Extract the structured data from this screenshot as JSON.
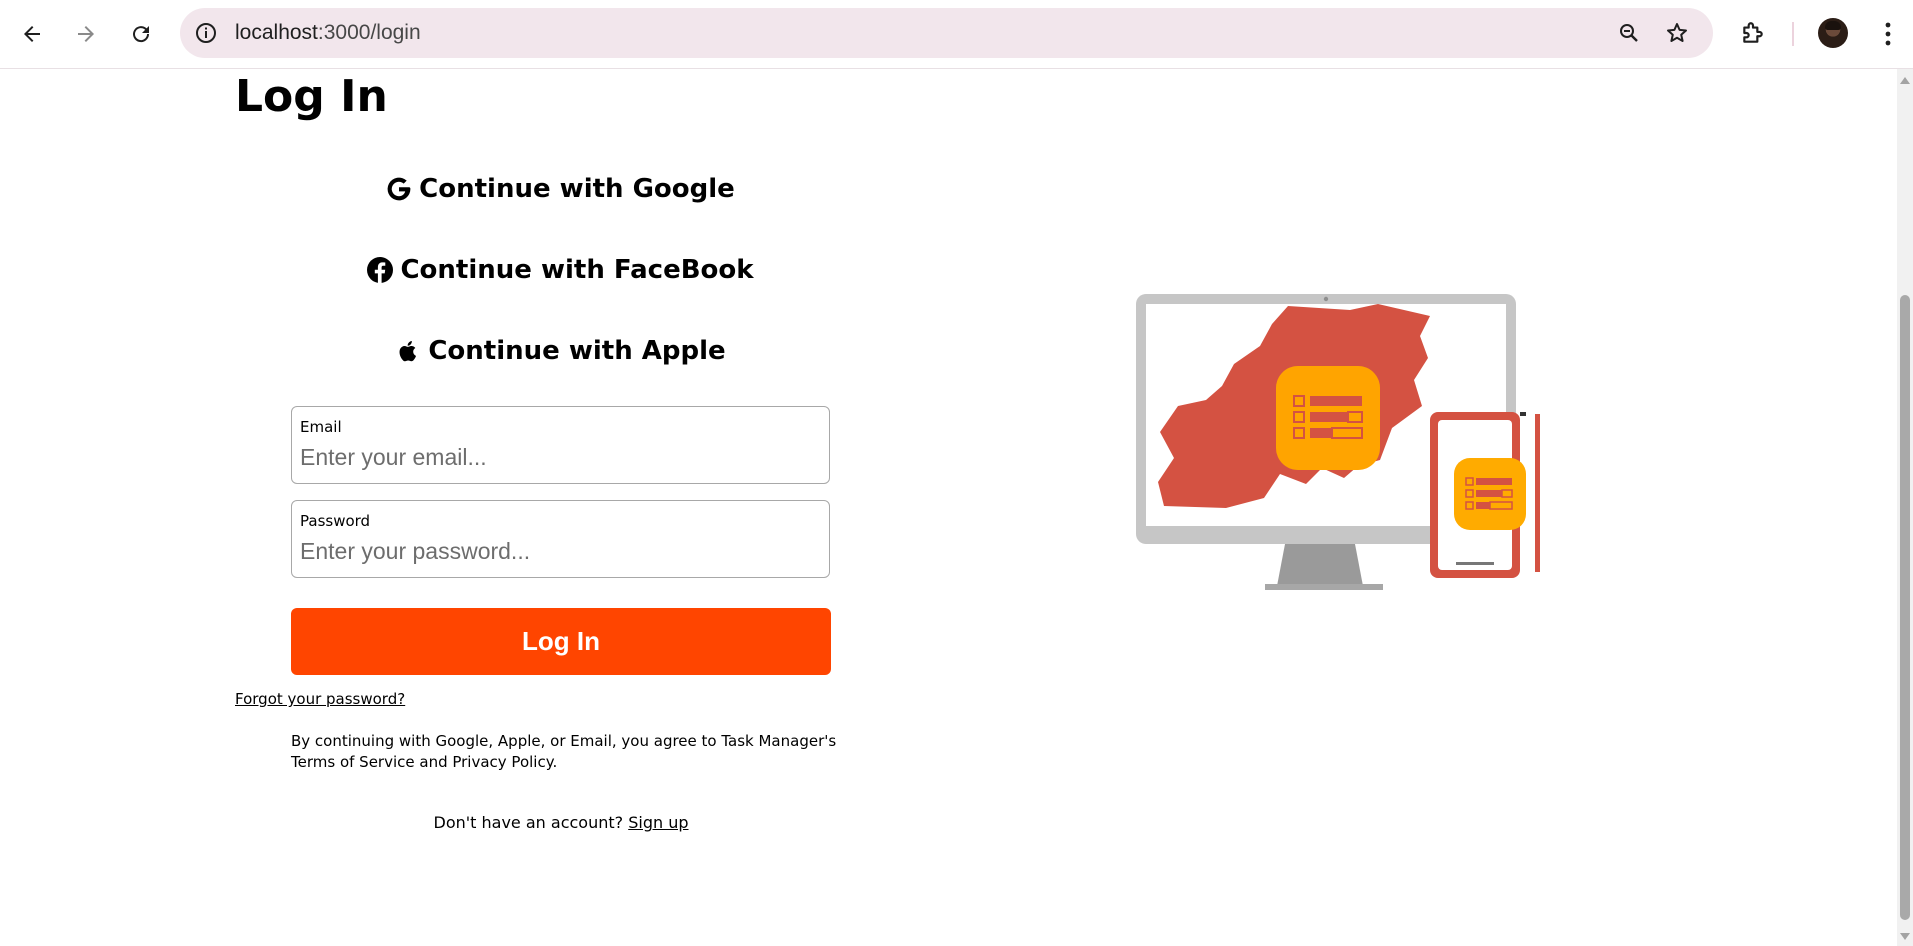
{
  "browser": {
    "url_host": "localhost",
    "url_path": ":3000/login",
    "icons": {
      "back": "back-arrow-icon",
      "forward": "forward-arrow-icon",
      "reload": "reload-icon",
      "site_info": "info-icon",
      "zoom": "zoom-out-icon",
      "bookmark": "star-icon",
      "extensions": "puzzle-icon",
      "profile": "avatar",
      "menu": "kebab-menu-icon"
    }
  },
  "page": {
    "title": "Log In",
    "social": {
      "google": {
        "label": "Continue with Google",
        "icon": "google-icon"
      },
      "facebook": {
        "label": "Continue with FaceBook",
        "icon": "facebook-icon"
      },
      "apple": {
        "label": "Continue with Apple",
        "icon": "apple-icon"
      }
    },
    "form": {
      "email_label": "Email",
      "email_placeholder": "Enter your email...",
      "email_value": "",
      "password_label": "Password",
      "password_placeholder": "Enter your password...",
      "password_value": "",
      "submit_label": "Log In"
    },
    "forgot_password": "Forgot your password?",
    "terms": "By continuing with Google, Apple, or Email, you agree to Task Manager's Terms of Service and Privacy Policy.",
    "signup_prompt": "Don't have an account?",
    "signup_link": "Sign up"
  },
  "colors": {
    "primary": "#ff4500",
    "omnibox_bg": "#f2e6ec",
    "illustration_red": "#d45242",
    "illustration_orange": "#ffab00"
  }
}
